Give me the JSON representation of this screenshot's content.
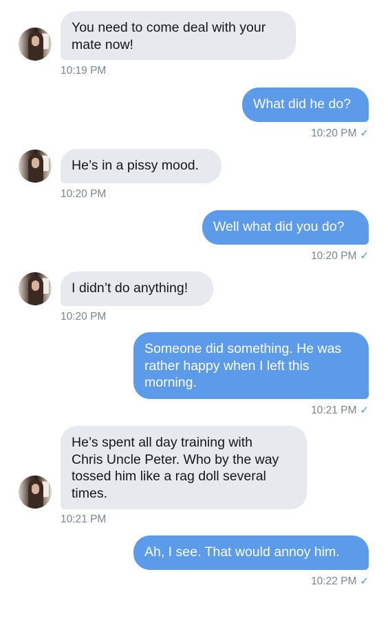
{
  "messages": [
    {
      "side": "in",
      "text": "You need to come deal with your\nmate now!",
      "time": "10:19 PM"
    },
    {
      "side": "out",
      "text": "What did he do?",
      "time": "10:20 PM",
      "read": true
    },
    {
      "side": "in",
      "text": "He’s in a pissy mood.",
      "time": "10:20 PM"
    },
    {
      "side": "out",
      "text": "Well what did you do?",
      "time": "10:20 PM",
      "read": true
    },
    {
      "side": "in",
      "text": "I didn’t do anything!",
      "time": "10:20 PM"
    },
    {
      "side": "out",
      "text": "Someone did something. He was\nrather happy when I left this\nmorning.",
      "time": "10:21 PM",
      "read": true
    },
    {
      "side": "in",
      "text": "He’s spent all day training with\nChris Uncle Peter. Who by the way\ntossed him like a rag doll several\ntimes.",
      "time": "10:21 PM"
    },
    {
      "side": "out",
      "text": "Ah, I see. That would annoy him.",
      "time": "10:22 PM",
      "read": true
    }
  ],
  "icons": {
    "read_receipt": "checkmark-icon",
    "avatar": "contact-avatar"
  }
}
